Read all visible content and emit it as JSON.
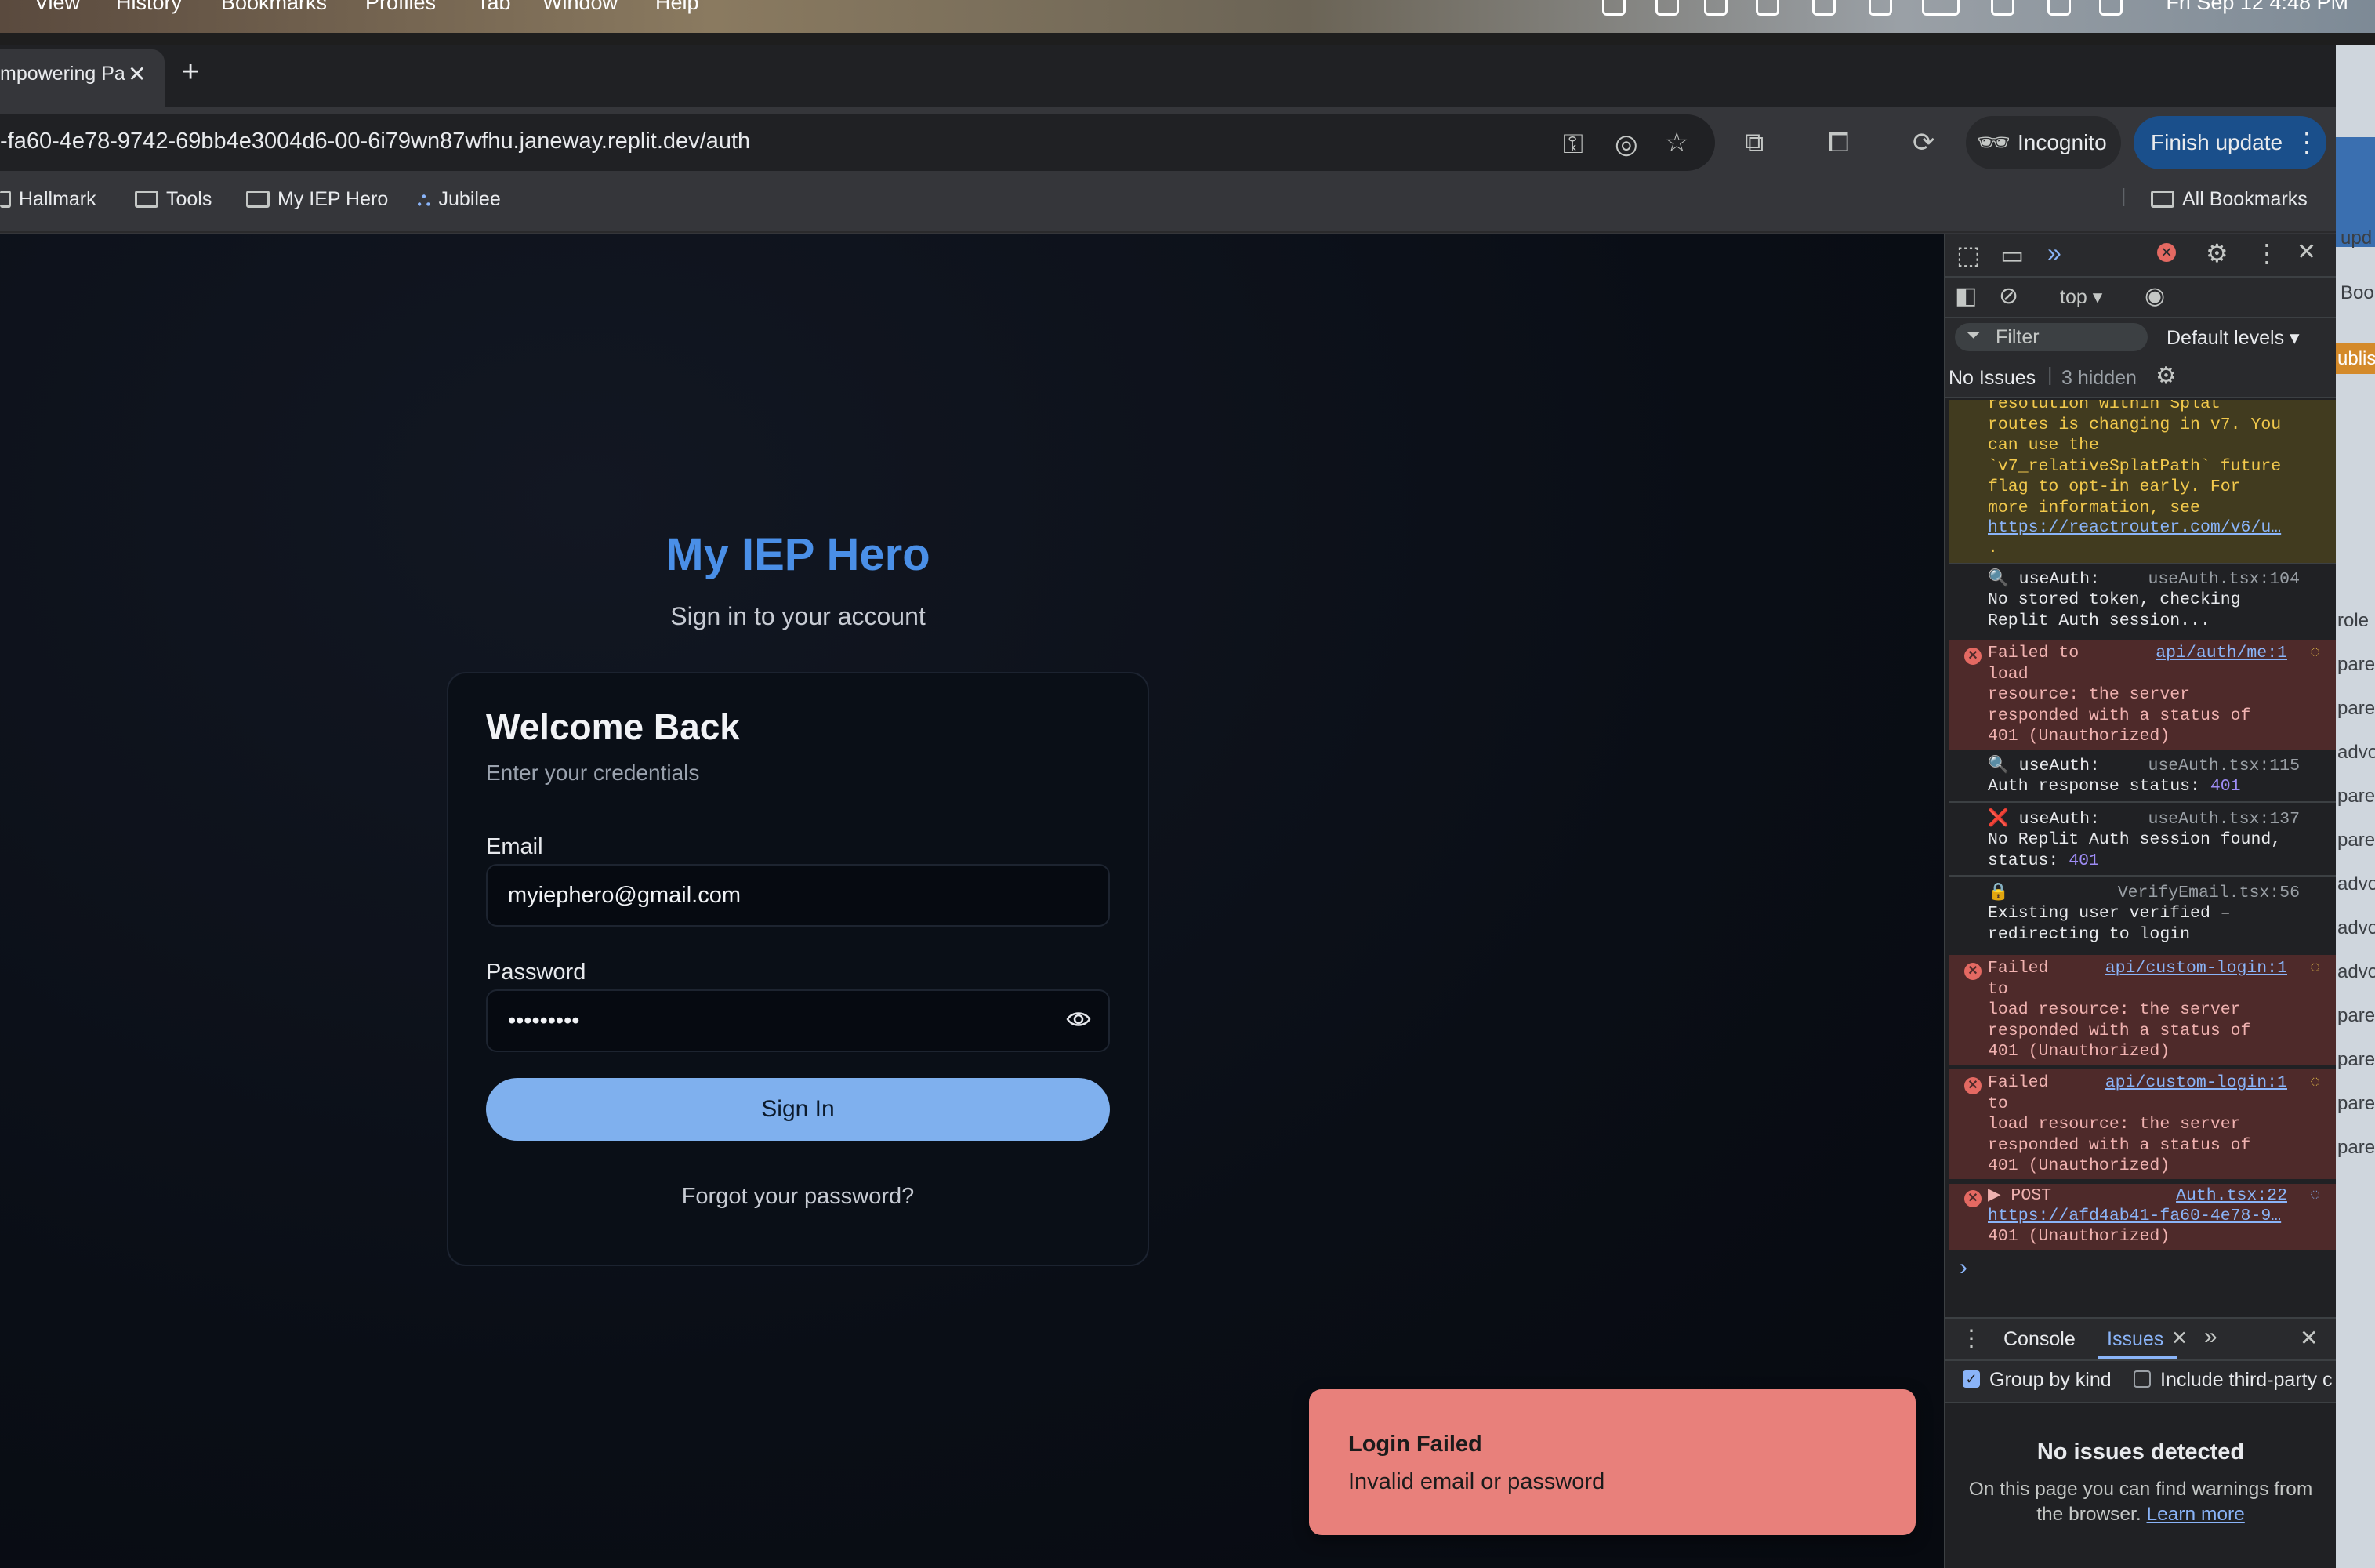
{
  "menubar": {
    "items": [
      "View",
      "History",
      "Bookmarks",
      "Profiles",
      "Tab",
      "Window",
      "Help"
    ],
    "clock": "Fri Sep 12  4:48 PM"
  },
  "browser": {
    "tab_title": "mpowering Pa",
    "url": "-fa60-4e78-9742-69bb4e3004d6-00-6i79wn87wfhu.janeway.replit.dev/auth",
    "incognito_label": "Incognito",
    "finish_update_label": "Finish update",
    "bookmarks": [
      "Hallmark",
      "Tools",
      "My IEP Hero",
      "Jubilee"
    ],
    "all_bookmarks": "All Bookmarks"
  },
  "app": {
    "brand": "My IEP Hero",
    "brand_subtitle": "Sign in to your account",
    "card_title": "Welcome Back",
    "card_subtitle": "Enter your credentials",
    "email_label": "Email",
    "email_value": "myiephero@gmail.com",
    "password_label": "Password",
    "password_value": "•••••••••",
    "signin_label": "Sign In",
    "forgot_label": "Forgot your password?"
  },
  "toast": {
    "title": "Login Failed",
    "message": "Invalid email or password"
  },
  "devtools": {
    "context": "top ▾",
    "filter_placeholder": "Filter",
    "levels": "Default levels ▾",
    "no_issues": "No Issues",
    "hidden": "3 hidden",
    "logs": {
      "warn_text": "resolution within Splat\nroutes is changing in v7. You\ncan use the\n`v7_relativeSplatPath` future\nflag to opt-in early. For\nmore information, see\n",
      "warn_link": "https://reactrouter.com/v6/u…",
      "warn_dot": ".",
      "l1_head": "🔍 useAuth:",
      "l1_src": "useAuth.tsx:104",
      "l1_body": "No stored token, checking\nReplit Auth session...",
      "e1_head": "Failed to\nload\nresource: the server\nresponded with a status of\n401 (Unauthorized)",
      "e1_src": "api/auth/me:1",
      "l2_head": "🔍 useAuth:",
      "l2_src": "useAuth.tsx:115",
      "l2_body": "Auth response status: ",
      "l2_num": "401",
      "l3_head": "❌ useAuth:",
      "l3_src": "useAuth.tsx:137",
      "l3_body": "No Replit Auth session found,\nstatus: ",
      "l3_num": "401",
      "l4_head": "🔒",
      "l4_src": "VerifyEmail.tsx:56",
      "l4_body": "Existing user verified –\nredirecting to login",
      "e2_head": "Failed\nto\nload resource: the server\nresponded with a status of\n401 (Unauthorized)",
      "e2_src": "api/custom-login:1",
      "e3_head": "Failed\nto\nload resource: the server\nresponded with a status of\n401 (Unauthorized)",
      "e3_src": "api/custom-login:1",
      "e4_head": "▶ POST",
      "e4_src": "Auth.tsx:22",
      "e4_link": "https://afd4ab41-fa60-4e78-9…",
      "e4_body": "401 (Unauthorized)"
    },
    "prompt": "›",
    "bottom_tabs": [
      "Console",
      "Issues"
    ],
    "group_by_kind": "Group by kind",
    "include_third_party": "Include third-party c",
    "no_issues_detected": "No issues detected",
    "no_issues_desc": "On this page you can find warnings from the browser.",
    "learn_more": "Learn more"
  },
  "right_peek": [
    "upd",
    "Boo",
    "ublis",
    "role",
    "pare",
    "pare",
    "advo",
    "pare",
    "pare",
    "advo",
    "advo",
    "advo",
    "pare",
    "pare",
    "pare",
    "pare"
  ],
  "colors": {
    "brand": "#4a8fe7",
    "button": "#7fb0ee",
    "toast": "#e8807b",
    "finish_update": "#1a4f8b"
  }
}
